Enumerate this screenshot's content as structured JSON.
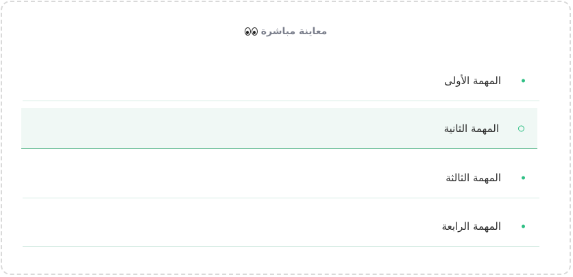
{
  "header": {
    "title": "معاينة مباشرة",
    "icon": "eyes-icon"
  },
  "tasks": [
    {
      "label": "المهمة الأولى",
      "state": "dot"
    },
    {
      "label": "المهمة الثانية",
      "state": "ring"
    },
    {
      "label": "المهمة الثالثة",
      "state": "dot"
    },
    {
      "label": "المهمة الرابعة",
      "state": "dot"
    }
  ],
  "colors": {
    "accent": "#2fbf84",
    "active_bg": "#f0f8f5",
    "active_border": "#3eaa78",
    "divider": "#d7ece4"
  }
}
